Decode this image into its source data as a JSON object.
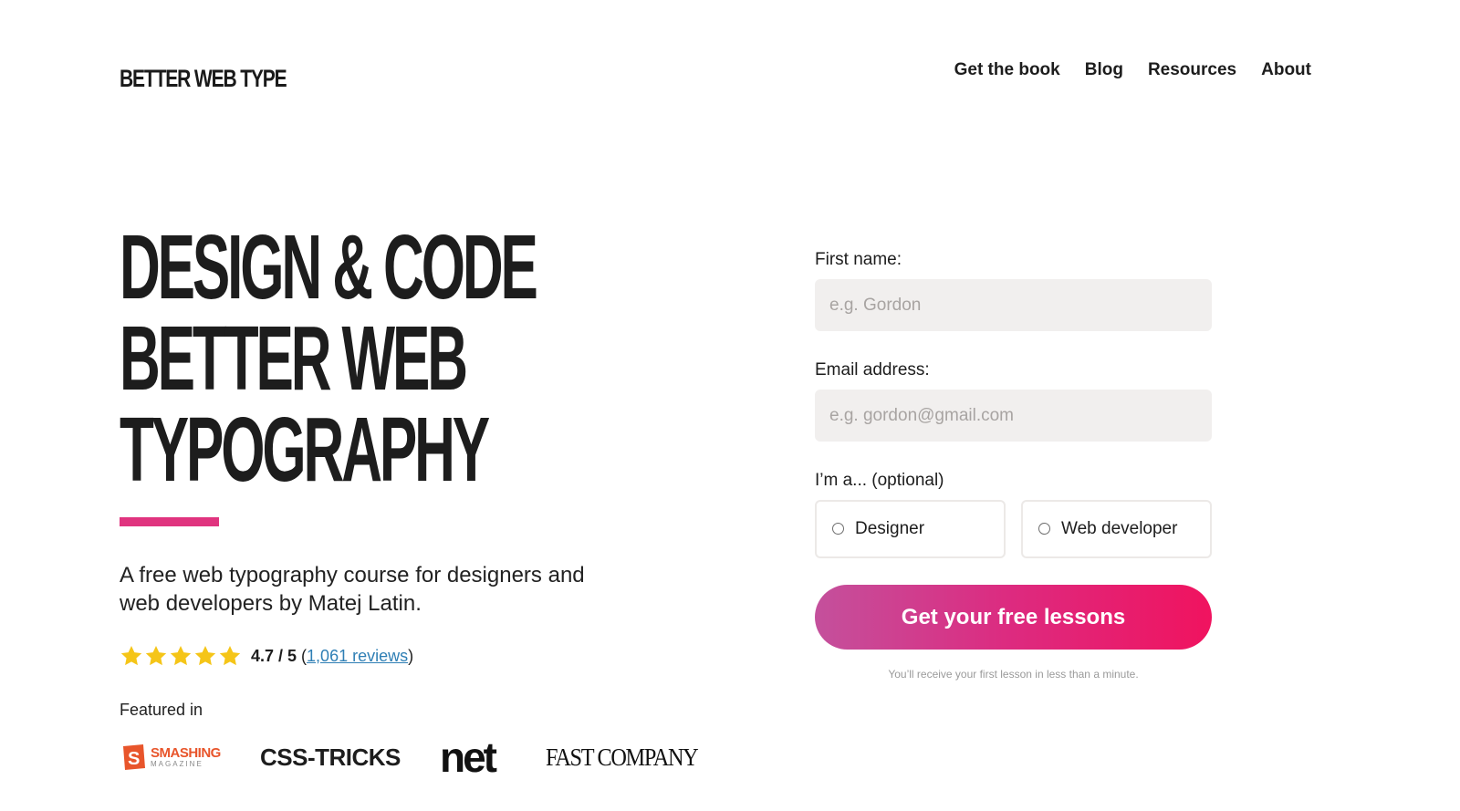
{
  "header": {
    "logo": "BETTER WEB TYPE",
    "nav": [
      "Get the book",
      "Blog",
      "Resources",
      "About"
    ]
  },
  "hero": {
    "headline_lines": [
      "DESIGN & CODE",
      "BETTER WEB",
      "TYPOGRAPHY"
    ],
    "subtitle": "A free web typography course for designers and web developers by Matej Latin.",
    "rating": {
      "stars": 5,
      "score": "4.7 / 5",
      "open_paren": "(",
      "reviews_link": "1,061 reviews",
      "close_paren": ")"
    },
    "featured_label": "Featured in",
    "press": {
      "smashing_top": "SMASHING",
      "smashing_bottom": "MAGAZINE",
      "smashing_mark": "S",
      "css_tricks": "CSS-TRICKS",
      "net": "net",
      "fast_company": "FAST COMPANY"
    }
  },
  "form": {
    "first_name_label": "First name:",
    "first_name_placeholder": "e.g. Gordon",
    "first_name_value": "",
    "email_label": "Email address:",
    "email_placeholder": "e.g. gordon@gmail.com",
    "email_value": "",
    "role_label": "I’m a... (optional)",
    "role_options": [
      "Designer",
      "Web developer"
    ],
    "submit_label": "Get your free lessons",
    "note": "You’ll receive your first lesson in less than a minute."
  },
  "colors": {
    "accent": "#e0347f",
    "star": "#f5c518",
    "link": "#2f7fb5",
    "input_bg": "#f1efee",
    "button_gradient_start": "#c4509c",
    "button_gradient_end": "#f0135f"
  },
  "icons": {
    "rating": "star-icon",
    "radio": "radio-unchecked-icon",
    "smashing": "smashing-s-logo-icon"
  }
}
